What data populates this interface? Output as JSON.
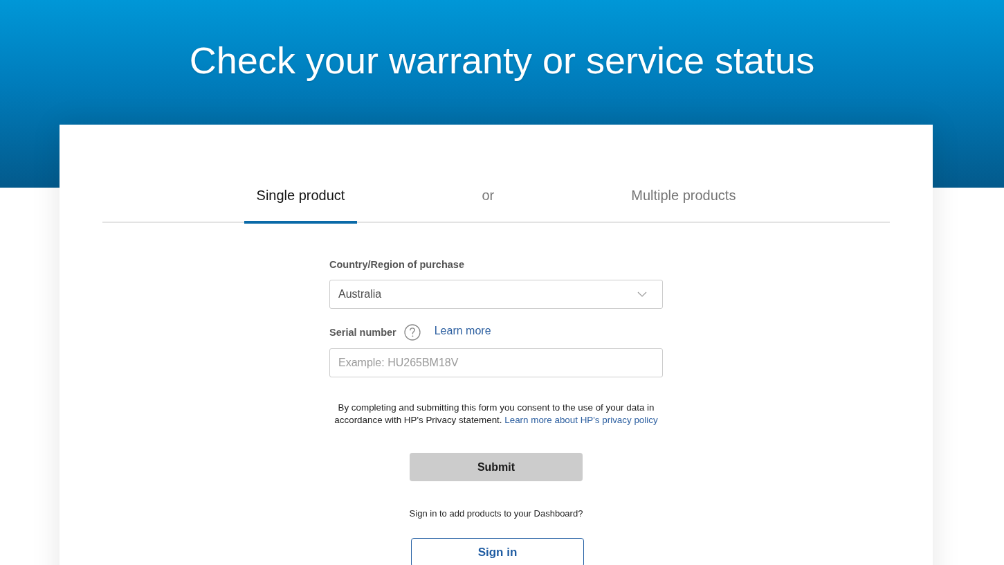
{
  "header": {
    "title": "Check your warranty or service status"
  },
  "tabs": [
    {
      "label": "Single product",
      "selected": true
    },
    {
      "label": "Multiple products",
      "selected": false
    }
  ],
  "tab_separator": "or",
  "form": {
    "country": {
      "label": "Country/Region of purchase",
      "value": "Australia"
    },
    "serial": {
      "label": "Serial number",
      "help_link": "Learn more",
      "placeholder": "Example: HU265BM18V"
    },
    "consent": {
      "text": "By completing and submitting this form you consent to the use of your data in accordance with HP's Privacy statement.",
      "link": "Learn more about HP's privacy policy"
    },
    "submit": {
      "label": "Submit",
      "disabled": true
    }
  },
  "sign_in": {
    "prompt": "Sign in to add products to your Dashboard?",
    "button": "Sign in"
  }
}
